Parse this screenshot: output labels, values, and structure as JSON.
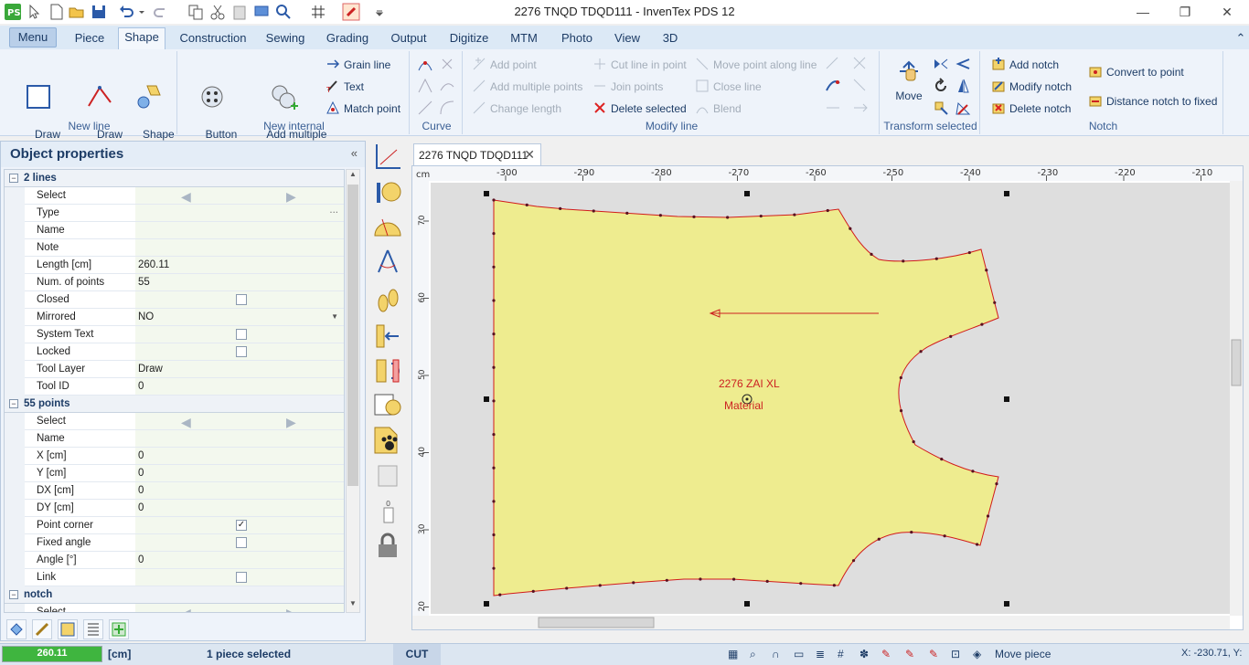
{
  "window": {
    "title": "2276 TNQD TDQD111 - InvenTex PDS 12",
    "minimize": "—",
    "restore": "❐",
    "close": "✕"
  },
  "tabs": [
    "Menu",
    "Piece",
    "Shape",
    "Construction",
    "Sewing",
    "Grading",
    "Output",
    "Digitize",
    "MTM",
    "Photo",
    "View",
    "3D"
  ],
  "active_tab": "Shape",
  "ribbon": {
    "new_line": {
      "label": "New line",
      "draw_rectangle": "Draw\nRectangle ▾",
      "draw_line": "Draw\nLine ▾",
      "shape_library": "Shape\nlibrary ▾"
    },
    "new_internal": {
      "label": "New internal",
      "button_add_mark": "Button\nAdd mark",
      "add_multiple_button_marks": "Add multiple\nbutton marks",
      "grain_line": "Grain line",
      "text": "Text",
      "match_point": "Match point"
    },
    "curve": {
      "label": "Curve"
    },
    "modify_line": {
      "label": "Modify line",
      "add_point": "Add point",
      "add_multiple_points": "Add multiple points",
      "change_length": "Change length",
      "cut_line_in_point": "Cut line in point",
      "join_points": "Join points",
      "delete_selected": "Delete selected",
      "move_point_along_line": "Move point along line",
      "close_line": "Close line",
      "blend": "Blend"
    },
    "transform_selected": {
      "label": "Transform selected",
      "move": "Move"
    },
    "notch": {
      "label": "Notch",
      "add_notch": "Add notch",
      "modify_notch": "Modify notch",
      "delete_notch": "Delete notch",
      "convert_to_point": "Convert to point",
      "distance_notch_to_fixed": "Distance notch to fixed"
    }
  },
  "object_properties": {
    "title": "Object properties",
    "collapse": "«",
    "section_lines": {
      "title": "2 lines",
      "rows": [
        {
          "k": "Select",
          "v": "",
          "kind": "arrows"
        },
        {
          "k": "Type",
          "v": "",
          "kind": "dots"
        },
        {
          "k": "Name",
          "v": ""
        },
        {
          "k": "Note",
          "v": ""
        },
        {
          "k": "Length [cm]",
          "v": "260.11"
        },
        {
          "k": "Num. of points",
          "v": "55"
        },
        {
          "k": "Closed",
          "v": "",
          "kind": "check",
          "checked": false
        },
        {
          "k": "Mirrored",
          "v": "NO",
          "kind": "dropdown"
        },
        {
          "k": "System Text",
          "v": "",
          "kind": "check",
          "checked": false
        },
        {
          "k": "Locked",
          "v": "",
          "kind": "check",
          "checked": false
        },
        {
          "k": "Tool Layer",
          "v": "Draw"
        },
        {
          "k": "Tool ID",
          "v": "0"
        }
      ]
    },
    "section_points": {
      "title": "55 points",
      "rows": [
        {
          "k": "Select",
          "v": "",
          "kind": "arrows"
        },
        {
          "k": "Name",
          "v": ""
        },
        {
          "k": "X [cm]",
          "v": "0"
        },
        {
          "k": "Y [cm]",
          "v": "0"
        },
        {
          "k": "DX [cm]",
          "v": "0"
        },
        {
          "k": "DY [cm]",
          "v": "0"
        },
        {
          "k": "Point corner",
          "v": "",
          "kind": "check",
          "checked": true
        },
        {
          "k": "Fixed angle",
          "v": "",
          "kind": "check",
          "checked": false
        },
        {
          "k": "Angle [°]",
          "v": "0"
        },
        {
          "k": "Link",
          "v": "",
          "kind": "check",
          "checked": false
        }
      ]
    },
    "section_notch": {
      "title": "notch",
      "rows": [
        {
          "k": "Select",
          "v": "",
          "kind": "arrows"
        }
      ]
    }
  },
  "document": {
    "tab_title": "2276 TNQD TDQD111",
    "unit": "cm",
    "x_ticks": [
      "-300",
      "-290",
      "-280",
      "-270",
      "-260",
      "-250",
      "-240",
      "-230",
      "-220",
      "-210"
    ],
    "y_ticks": [
      "70",
      "60",
      "50",
      "40",
      "30",
      "20"
    ],
    "piece_label": "2276 ZAI XL",
    "material_label": "Material",
    "piece_color": "#eeec8f",
    "outline_color": "#d11a1a"
  },
  "status": {
    "length_value": "260.11",
    "length_unit": "[cm]",
    "selection": "1 piece selected",
    "mode": "CUT",
    "hint": "Move piece",
    "coords": "X: -230.71, Y:"
  },
  "colors": {
    "accent": "#1d3c66",
    "ribbon_bg": "#eef3fa",
    "progress": "#3fb53f"
  }
}
